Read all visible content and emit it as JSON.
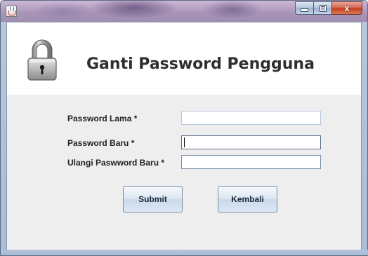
{
  "window": {
    "title": "",
    "controls": {
      "minimize_icon": "minimize-icon",
      "maximize_icon": "maximize-icon",
      "close_icon": "close-icon",
      "close_glyph": "x"
    }
  },
  "header": {
    "icon": "padlock-icon",
    "title": "Ganti Password Pengguna"
  },
  "form": {
    "fields": [
      {
        "label": "Password Lama *",
        "value": ""
      },
      {
        "label": "Password Baru *",
        "value": ""
      },
      {
        "label": "Ulangi Paswword Baru *",
        "value": ""
      }
    ]
  },
  "buttons": {
    "submit": "Submit",
    "back": "Kembali"
  },
  "colors": {
    "close_button": "#c2391f",
    "content_background": "#eeeeee",
    "header_background": "#ffffff"
  }
}
